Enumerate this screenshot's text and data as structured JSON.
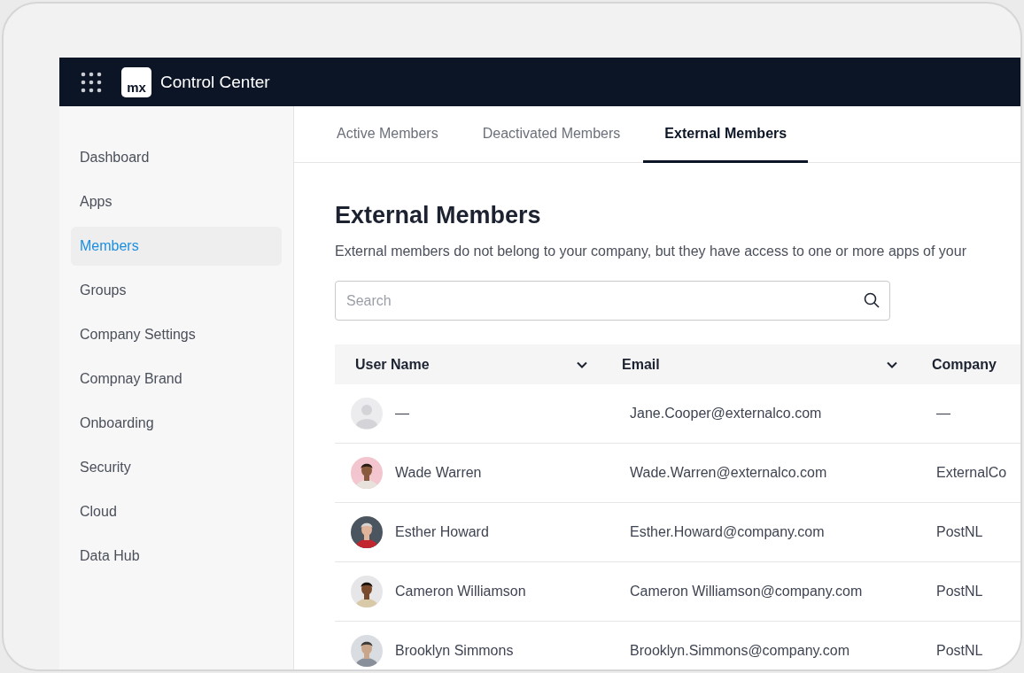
{
  "header": {
    "logo": "mx",
    "title": "Control Center"
  },
  "sidebar": {
    "items": [
      {
        "label": "Dashboard",
        "selected": false
      },
      {
        "label": "Apps",
        "selected": false
      },
      {
        "label": "Members",
        "selected": true
      },
      {
        "label": "Groups",
        "selected": false
      },
      {
        "label": "Company Settings",
        "selected": false
      },
      {
        "label": "Compnay Brand",
        "selected": false
      },
      {
        "label": "Onboarding",
        "selected": false
      },
      {
        "label": "Security",
        "selected": false
      },
      {
        "label": "Cloud",
        "selected": false
      },
      {
        "label": "Data Hub",
        "selected": false
      }
    ]
  },
  "tabs": [
    {
      "label": "Active Members",
      "selected": false
    },
    {
      "label": "Deactivated Members",
      "selected": false
    },
    {
      "label": "External Members",
      "selected": true
    }
  ],
  "page": {
    "title": "External Members",
    "description": "External members do not belong to your company, but they have access to one or more apps of your"
  },
  "search": {
    "placeholder": "Search"
  },
  "table": {
    "columns": [
      {
        "label": "User Name",
        "sortable": true
      },
      {
        "label": "Email",
        "sortable": true
      },
      {
        "label": "Company",
        "sortable": false
      }
    ],
    "rows": [
      {
        "kind": "placeholder",
        "name": "—",
        "email": "Jane.Cooper@externalco.com",
        "company": "—"
      },
      {
        "kind": "picture",
        "name": "Wade Warren",
        "email": "Wade.Warren@externalco.com",
        "company": "ExternalCo"
      },
      {
        "kind": "picture",
        "name": "Esther Howard",
        "email": "Esther.Howard@company.com",
        "company": "PostNL"
      },
      {
        "kind": "picture",
        "name": "Cameron Williamson",
        "email": "Cameron Williamson@company.com",
        "company": "PostNL"
      },
      {
        "kind": "picture",
        "name": "Brooklyn Simmons",
        "email": "Brooklyn.Simmons@company.com",
        "company": "PostNL"
      }
    ]
  }
}
